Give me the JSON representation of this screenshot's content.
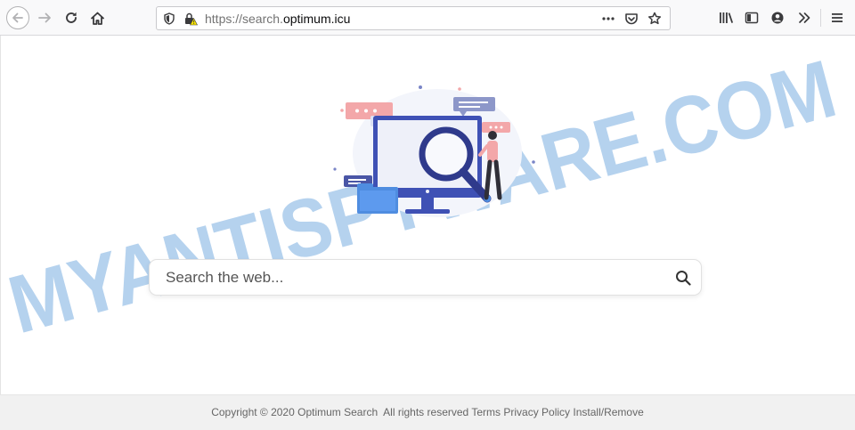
{
  "browser": {
    "url_scheme": "https://search.",
    "url_host": "optimum.icu"
  },
  "search": {
    "placeholder": "Search the web..."
  },
  "watermark": {
    "text": "MYANTISPYWARE.COM",
    "color": "#5b9bd9"
  },
  "footer": {
    "copyright": "Copyright © 2020 Optimum Search",
    "rights": "All rights reserved",
    "terms": "Terms",
    "privacy": "Privacy Policy",
    "install": "Install/Remove"
  },
  "colors": {
    "accent_blue": "#3f51b5",
    "illustration_pink": "#f3a7a9",
    "illustration_lilac": "#8d97c9"
  },
  "icons": [
    "back-arrow-icon",
    "forward-arrow-icon",
    "reload-icon",
    "home-icon",
    "shield-icon",
    "insecure-lock-icon",
    "page-actions-icon",
    "pocket-icon",
    "bookmark-star-icon",
    "library-icon",
    "sidebar-icon",
    "account-icon",
    "overflow-icon",
    "menu-icon",
    "search-icon"
  ]
}
